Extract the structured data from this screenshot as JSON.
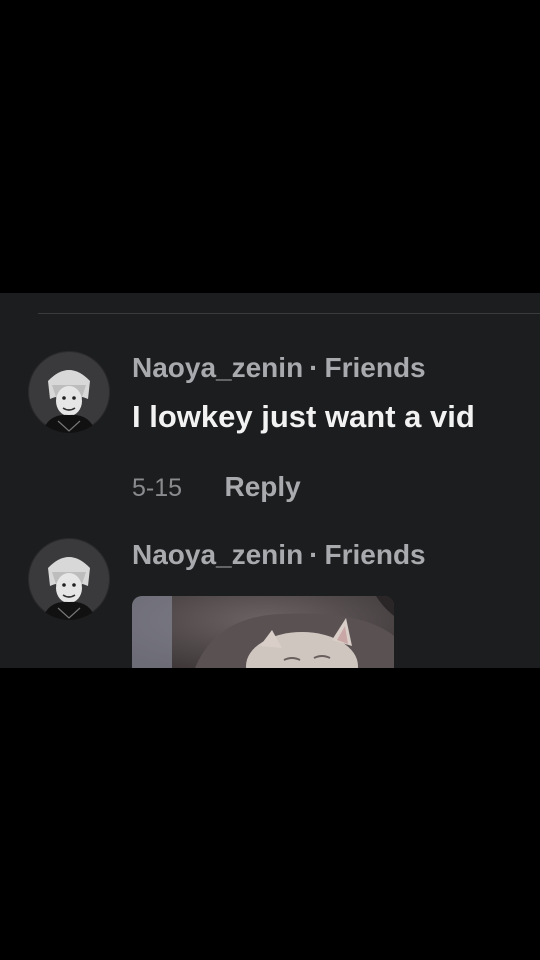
{
  "comments": [
    {
      "username": "Naoya_zenin",
      "separator": "·",
      "relation": "Friends",
      "text": "I lowkey just want a vid",
      "date": "5-15",
      "reply_label": "Reply"
    },
    {
      "username": "Naoya_zenin",
      "separator": "·",
      "relation": "Friends",
      "media": "cat-photo"
    }
  ],
  "colors": {
    "background": "#1c1d1f",
    "letterbox": "#000000",
    "username": "#a9aaad",
    "text": "#f2f2f2",
    "meta": "#8a8b8e"
  },
  "icons": {
    "avatar": "avatar-icon"
  }
}
